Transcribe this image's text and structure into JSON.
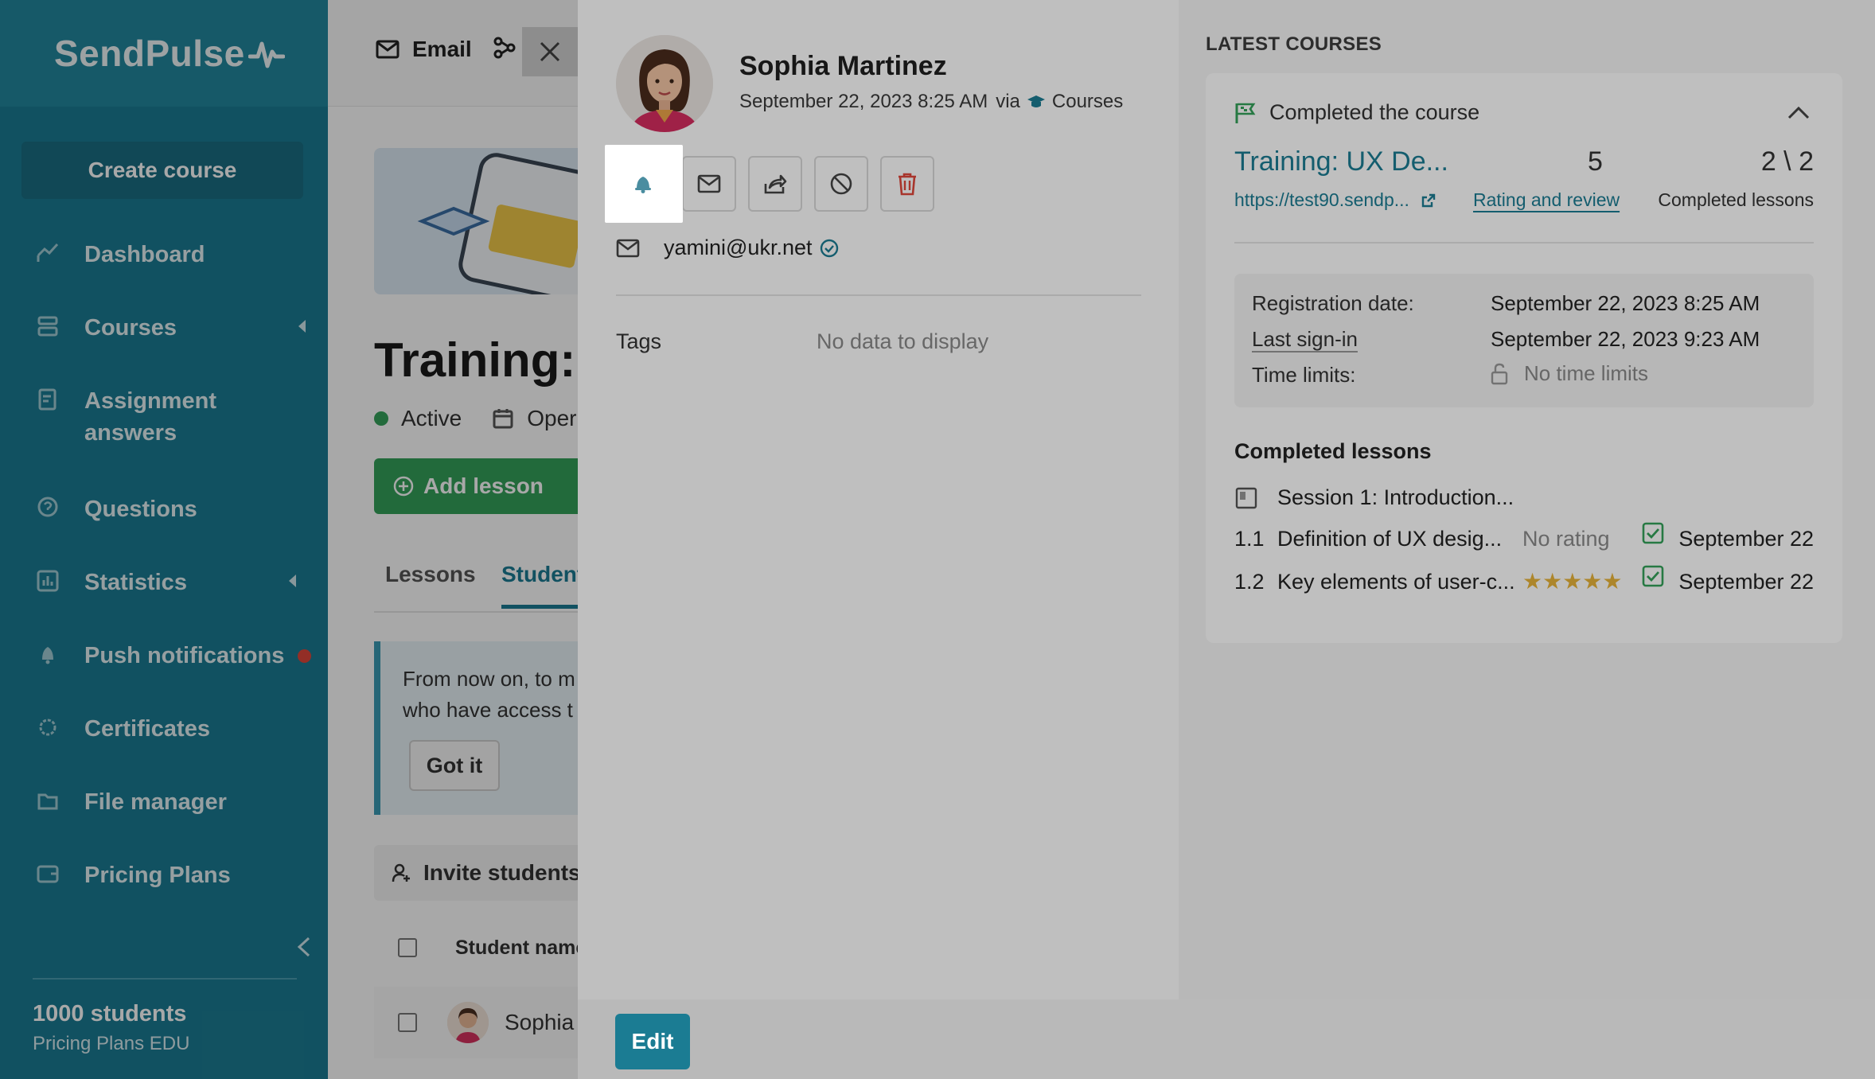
{
  "sidebar": {
    "logo": "SendPulse",
    "create_course": "Create course",
    "items": [
      {
        "label": "Dashboard",
        "icon": "chart-line-icon"
      },
      {
        "label": "Courses",
        "icon": "courses-icon"
      },
      {
        "label": "Assignment answers",
        "icon": "assignment-icon"
      },
      {
        "label": "Questions",
        "icon": "question-icon"
      },
      {
        "label": "Statistics",
        "icon": "statistics-icon"
      },
      {
        "label": "Push notifications",
        "icon": "bell-icon"
      },
      {
        "label": "Certificates",
        "icon": "certificate-icon"
      },
      {
        "label": "File manager",
        "icon": "folder-icon"
      },
      {
        "label": "Pricing Plans",
        "icon": "wallet-icon"
      }
    ],
    "students_count": "1000 students",
    "plan_name": "Pricing Plans EDU"
  },
  "topbar": {
    "email_label": "Email"
  },
  "background_page": {
    "title": "Training: U",
    "status": "Active",
    "open_label": "Oper",
    "add_lesson": "Add lesson",
    "tabs": [
      "Lessons",
      "Student"
    ],
    "notice_line1": "From now on, to m",
    "notice_line2": "who have access t",
    "got_it": "Got it",
    "invite_students": "Invite students",
    "col_student_name": "Student name",
    "row_student": "Sophia"
  },
  "profile": {
    "name": "Sophia Martinez",
    "date": "September 22, 2023 8:25 AM",
    "via": "via",
    "source": "Courses",
    "email": "yamini@ukr.net",
    "tags_label": "Tags",
    "tags_value": "No data to display",
    "edit_button": "Edit"
  },
  "latest_courses": {
    "title": "LATEST COURSES",
    "status": "Completed the course",
    "course_title": "Training: UX De...",
    "rating_number": "5",
    "lessons_progress": "2 \\ 2",
    "course_url": "https://test90.sendp...",
    "rating_link": "Rating and review",
    "completed_lessons_label": "Completed lessons",
    "registration_label": "Registration date:",
    "registration_value": "September 22, 2023 8:25 AM",
    "last_signin_label": "Last sign-in",
    "last_signin_value": "September 22, 2023 9:23 AM",
    "time_limits_label": "Time limits:",
    "time_limits_value": "No time limits",
    "completed_lessons_title": "Completed lessons",
    "session": "Session 1: Introduction...",
    "lessons": [
      {
        "no": "1.1",
        "name": "Definition of UX desig...",
        "rating": "No rating",
        "date": "September 22"
      },
      {
        "no": "1.2",
        "name": "Key elements of user-c...",
        "stars": "★★★★★",
        "date": "September 22"
      }
    ]
  },
  "colors": {
    "sidebar": "#1b7c93",
    "accent": "#1b7c93",
    "success": "#34a25a",
    "star": "#e7b33a",
    "danger": "#e0473b"
  }
}
